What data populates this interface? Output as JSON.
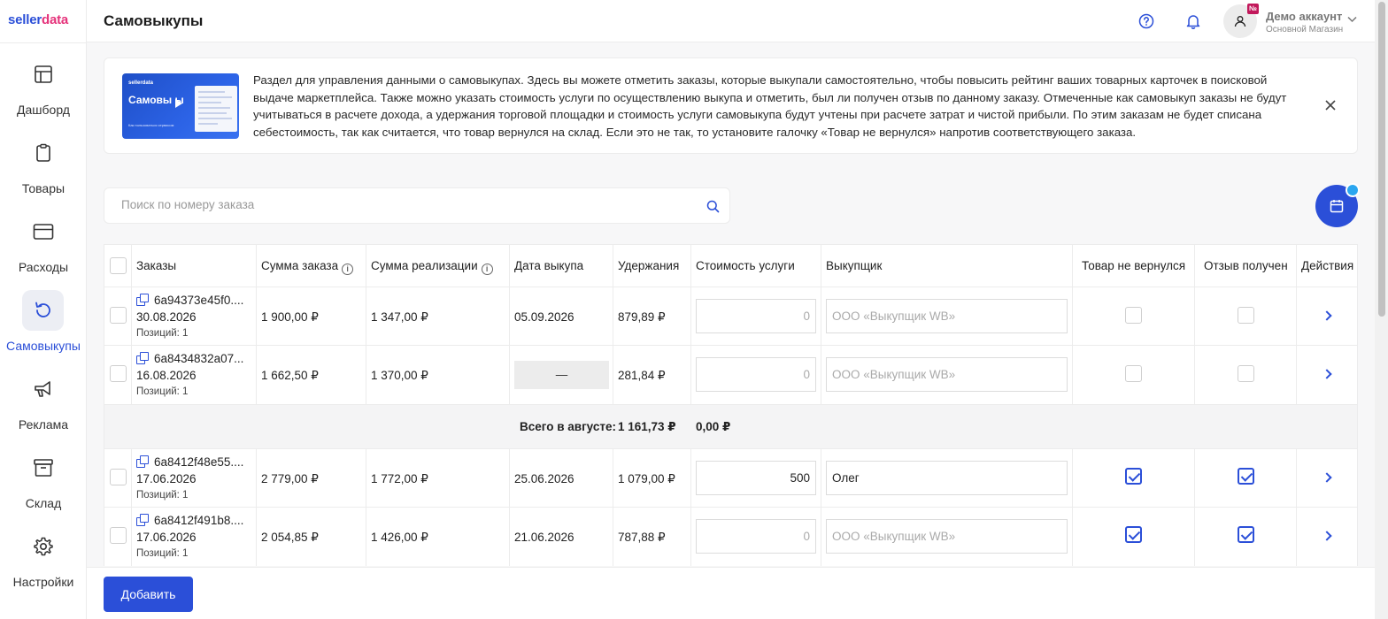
{
  "brand": {
    "logo_main": "sellerdata",
    "accent_color": "#2b4fd8",
    "logo_accent_color": "#e5327a"
  },
  "sidebar": {
    "items": [
      {
        "label": "Дашборд",
        "icon": "dashboard-icon",
        "active": false
      },
      {
        "label": "Товары",
        "icon": "clipboard-icon",
        "active": false
      },
      {
        "label": "Расходы",
        "icon": "credit-card-icon",
        "active": false
      },
      {
        "label": "Самовыкупы",
        "icon": "refresh-icon",
        "active": true
      },
      {
        "label": "Реклама",
        "icon": "megaphone-icon",
        "active": false
      },
      {
        "label": "Склад",
        "icon": "archive-box-icon",
        "active": false
      },
      {
        "label": "Настройки",
        "icon": "gear-icon",
        "active": false
      }
    ]
  },
  "header": {
    "title": "Самовыкупы",
    "help_icon": "question-circle-icon",
    "notifications_icon": "bell-icon",
    "avatar_badge": "№",
    "account_name": "Демо аккаунт",
    "account_shop": "Основной Магазин"
  },
  "banner": {
    "thumb_brand": "sellerdata",
    "thumb_title": "Самовы   ы",
    "thumb_sub": "Как пользоваться сервисом",
    "text": "Раздел для управления данными о самовыкупах. Здесь вы можете отметить заказы, которые выкупали самостоятельно, чтобы повысить рейтинг ваших товарных карточек в поисковой выдаче маркетплейса. Также можно указать стоимость услуги по осуществлению выкупа и отметить, был ли получен отзыв по данному заказу. Отмеченные как самовыкуп заказы не будут учитываться в расчете дохода, а удержания торговой площадки и стоимость услуги самовыкупа будут учтены при расчете затрат и чистой прибыли. По этим заказам не будет списана себестоимость, так как считается, что товар вернулся на склад. Если это не так, то установите галочку «Товар не вернулся» напротив соответствующего заказа."
  },
  "search": {
    "placeholder": "Поиск по номеру заказа",
    "value": ""
  },
  "table": {
    "headers": {
      "orders": "Заказы",
      "order_sum": "Сумма заказа",
      "realization_sum": "Сумма реализации",
      "buyout_date": "Дата выкупа",
      "deductions": "Удержания",
      "service_cost": "Стоимость услуги",
      "buyer": "Выкупщик",
      "not_returned": "Товар не вернулся",
      "review_received": "Отзыв получен",
      "actions": "Действия"
    },
    "rows": [
      {
        "order_id": "6a94373e45f0....",
        "order_date": "30.08.2026",
        "positions": "Позиций: 1",
        "order_sum": "1 900,00 ₽",
        "realization_sum": "1 347,00 ₽",
        "buyout_date": "05.09.2026",
        "deductions": "879,89 ₽",
        "service_cost": "",
        "service_placeholder": "0",
        "buyer": "",
        "buyer_placeholder": "ООО «Выкупщик WB»",
        "not_returned": false,
        "review": false
      },
      {
        "order_id": "6a8434832a07...",
        "order_date": "16.08.2026",
        "positions": "Позиций: 1",
        "order_sum": "1 662,50 ₽",
        "realization_sum": "1 370,00 ₽",
        "buyout_date": "—",
        "deductions": "281,84 ₽",
        "service_cost": "",
        "service_placeholder": "0",
        "buyer": "",
        "buyer_placeholder": "ООО «Выкупщик WB»",
        "not_returned": false,
        "review": false
      },
      {
        "order_id": "6a8412f48e55....",
        "order_date": "17.06.2026",
        "positions": "Позиций: 1",
        "order_sum": "2 779,00 ₽",
        "realization_sum": "1 772,00 ₽",
        "buyout_date": "25.06.2026",
        "deductions": "1 079,00 ₽",
        "service_cost": "500",
        "service_placeholder": "0",
        "buyer": "Олег",
        "buyer_placeholder": "ООО «Выкупщик WB»",
        "not_returned": true,
        "review": true
      },
      {
        "order_id": "6a8412f491b8....",
        "order_date": "17.06.2026",
        "positions": "Позиций: 1",
        "order_sum": "2 054,85 ₽",
        "realization_sum": "1 426,00 ₽",
        "buyout_date": "21.06.2026",
        "deductions": "787,88 ₽",
        "service_cost": "",
        "service_placeholder": "0",
        "buyer": "",
        "buyer_placeholder": "ООО «Выкупщик WB»",
        "not_returned": true,
        "review": true
      }
    ],
    "summary": {
      "label": "Всего в августе:",
      "deductions_total": "1 161,73 ₽",
      "service_total": "0,00 ₽"
    }
  },
  "footer": {
    "add_label": "Добавить"
  }
}
